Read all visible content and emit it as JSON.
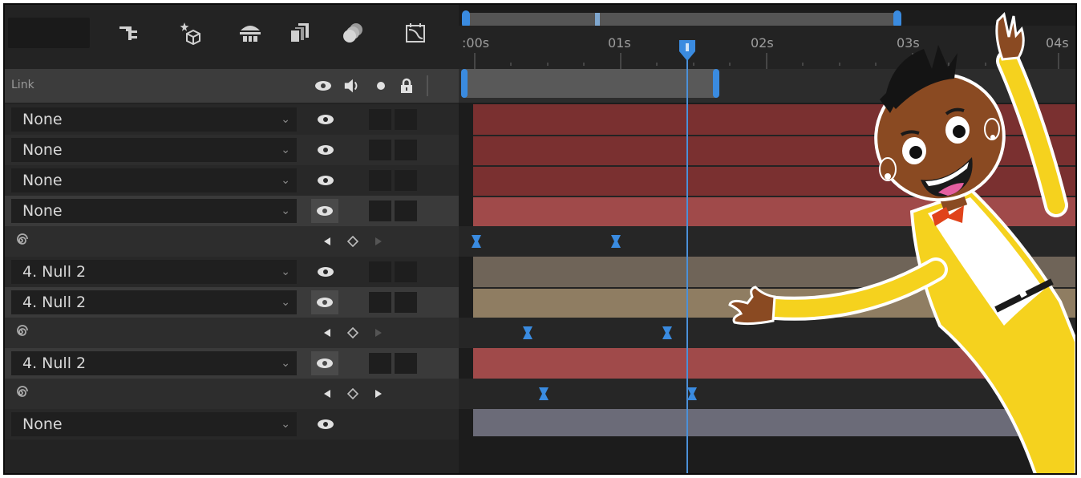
{
  "toolbar": {
    "comp_name": "",
    "tools": [
      "parent-hierarchy-icon",
      "draft-3d-icon",
      "3d-ground-icon",
      "frame-blending-icon",
      "motion-blur-icon",
      "graph-editor-icon"
    ]
  },
  "layer_header": {
    "parent_label": "Link",
    "column_icons": [
      "eye-icon",
      "speaker-icon",
      "solo-dot-icon",
      "lock-icon"
    ]
  },
  "rows": [
    {
      "type": "layer",
      "parent": "None",
      "track_color": "#7a3030"
    },
    {
      "type": "layer",
      "parent": "None",
      "track_color": "#7a3030"
    },
    {
      "type": "layer",
      "parent": "None",
      "track_color": "#7a3030"
    },
    {
      "type": "layer",
      "parent": "None",
      "track_color": "#a04a4a"
    },
    {
      "type": "property",
      "keyframe_times_s": [
        0.0,
        1.0
      ]
    },
    {
      "type": "layer",
      "parent": "4. Null 2",
      "track_color": "#6f6458"
    },
    {
      "type": "layer",
      "parent": "4. Null 2",
      "track_color": "#8f7d62"
    },
    {
      "type": "property",
      "keyframe_times_s": [
        0.35,
        1.35
      ]
    },
    {
      "type": "layer",
      "parent": "4. Null 2",
      "track_color": "#a04a4a"
    },
    {
      "type": "property",
      "keyframe_times_s": [
        0.45,
        1.45
      ]
    },
    {
      "type": "layer",
      "parent": "None",
      "track_color": "#6b6b78"
    }
  ],
  "timeline": {
    "ticks": [
      ":00s",
      "01s",
      "02s",
      "03s",
      "04s"
    ],
    "current_time_s": 1.45,
    "work_area_end_s": 1.7
  },
  "colors": {
    "accent_blue": "#4b90d8",
    "panel_bg": "#232323",
    "character_yellow": "#f5d21e"
  }
}
